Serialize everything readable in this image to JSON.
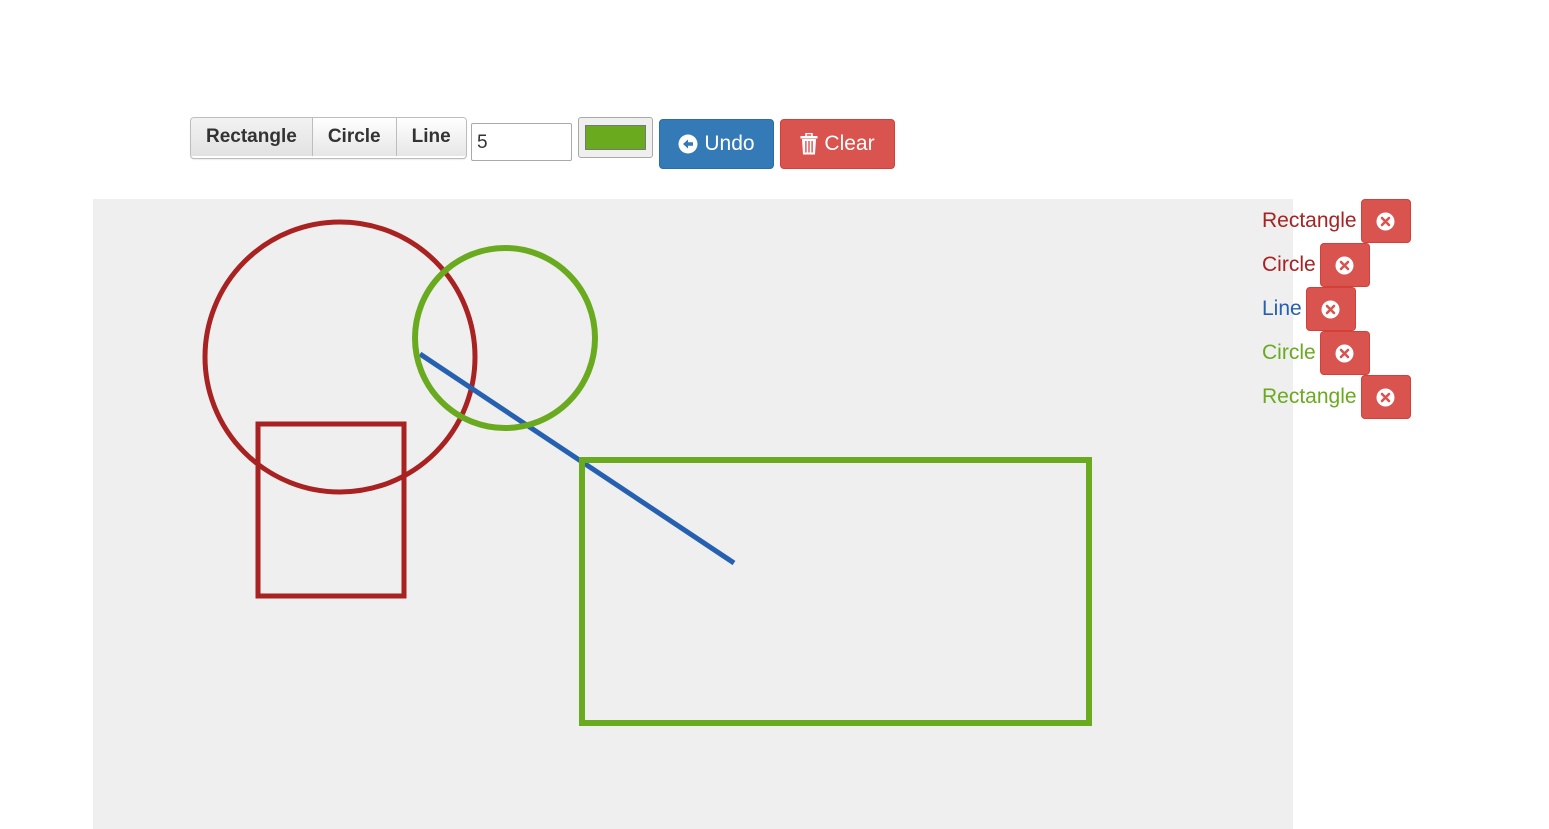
{
  "toolbar": {
    "tools": [
      "Rectangle",
      "Circle",
      "Line"
    ],
    "active_tool": "Rectangle",
    "line_width": "5",
    "current_color": "#6aaa1f",
    "undo_label": "Undo",
    "clear_label": "Clear"
  },
  "colors": {
    "red": "#a82222",
    "green": "#6aaa1f",
    "blue": "#2660b0",
    "canvas_bg": "#efefef",
    "danger": "#d9534f",
    "primary": "#337ab7"
  },
  "shapes": [
    {
      "type": "Rectangle",
      "label": "Rectangle",
      "color": "#a82222"
    },
    {
      "type": "Circle",
      "label": "Circle",
      "color": "#a82222"
    },
    {
      "type": "Line",
      "label": "Line",
      "color": "#2660b0"
    },
    {
      "type": "Circle",
      "label": "Circle",
      "color": "#6aaa1f"
    },
    {
      "type": "Rectangle",
      "label": "Rectangle",
      "color": "#6aaa1f"
    }
  ]
}
